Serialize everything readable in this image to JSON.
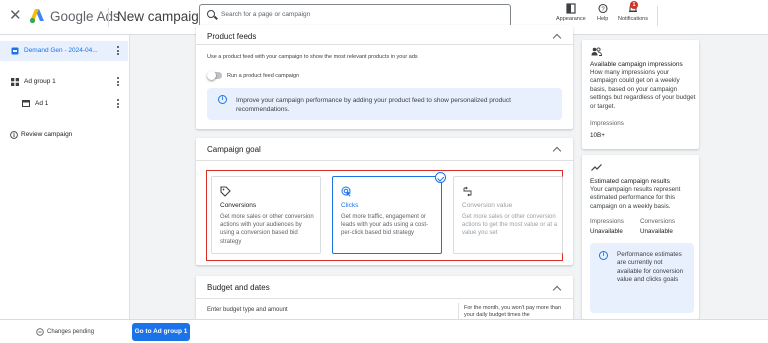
{
  "header": {
    "close_glyph": "✕",
    "brand_name": "Google Ads",
    "page_title": "New campaign",
    "search_placeholder": "Search for a page or campaign",
    "actions": [
      {
        "label": "Appearance",
        "icon": "appearance-icon"
      },
      {
        "label": "Help",
        "icon": "help-icon"
      },
      {
        "label": "Notifications",
        "icon": "bell-icon",
        "badge": "1"
      }
    ]
  },
  "sidebar": {
    "items": [
      {
        "label": "Demand Gen - 2024-04...",
        "icon": "campaign-icon",
        "active": true
      },
      {
        "label": "Ad group 1",
        "icon": "ad-group-icon",
        "active": false
      },
      {
        "label": "Ad 1",
        "icon": "ad-icon",
        "active": false
      },
      {
        "label": "Review campaign",
        "icon": "info-icon",
        "active": false
      }
    ]
  },
  "product_feeds": {
    "title": "Product feeds",
    "description": "Use a product feed with your campaign to show the most relevant products in your ads",
    "toggle_label": "Run a product feed campaign",
    "toggle_on": false,
    "info": "Improve your campaign performance by adding your product feed to show personalized product recommendations."
  },
  "campaign_goal": {
    "title": "Campaign goal",
    "options": [
      {
        "title": "Conversions",
        "description": "Get more sales or other conversion actions with your audiences by using a conversion based bid strategy",
        "selected": false,
        "disabled": false
      },
      {
        "title": "Clicks",
        "description": "Get more traffic, engagement or leads with your ads using a cost-per-click based bid strategy",
        "selected": true,
        "disabled": false
      },
      {
        "title": "Conversion value",
        "description": "Get more sales or other conversion actions to get the most value or at a value you set",
        "selected": false,
        "disabled": true
      }
    ]
  },
  "budget": {
    "title": "Budget and dates",
    "budget_type_label": "Enter budget type and amount",
    "note": "For the month, you won't pay more than your daily budget times the"
  },
  "impressions_panel": {
    "title": "Available campaign impressions",
    "description": "How many impressions your campaign could get on a weekly basis, based on your campaign settings but regardless of your budget or target.",
    "metric_label": "Impressions",
    "metric_value": "10B+"
  },
  "results_panel": {
    "title": "Estimated campaign results",
    "description": "Your campaign results represent estimated performance for this campaign on a weekly basis.",
    "col1_label": "Impressions",
    "col1_value": "Unavailable",
    "col2_label": "Conversions",
    "col2_value": "Unavailable",
    "info": "Performance estimates are currently not available for conversion value and clicks goals"
  },
  "footer": {
    "status": "Changes pending",
    "next_button": "Go to Ad group 1"
  },
  "colors": {
    "accent": "#1a73e8",
    "highlight_outline": "#d93025",
    "info_bg": "#e8f0fe"
  }
}
